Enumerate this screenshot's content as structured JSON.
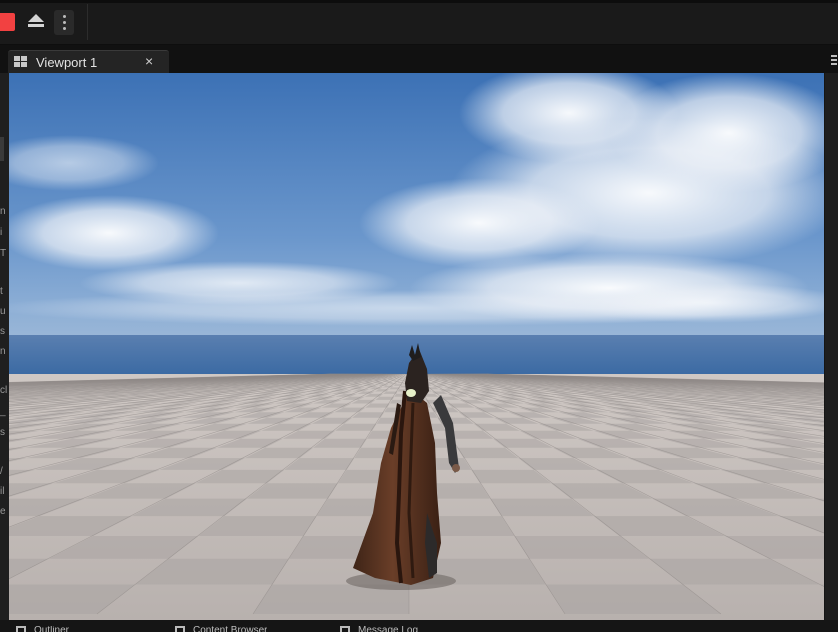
{
  "toolbar": {
    "stop_icon": "stop-square-icon",
    "eject_icon": "eject-icon",
    "more_icon": "vertical-ellipsis-icon",
    "stop_color": "#f24141"
  },
  "viewport_tab": {
    "label": "Viewport 1",
    "close": "×",
    "icon": "viewport-grid-icon"
  },
  "left_panel_cut_letters": [
    "n",
    "i",
    "T",
    "t",
    "u",
    "s",
    "n",
    "cl",
    "_",
    "s",
    "/",
    "il",
    "e"
  ],
  "bottom_tabs": [
    {
      "icon": "outliner-icon",
      "label": "Outliner"
    },
    {
      "icon": "content-browser-icon",
      "label": "Content Browser"
    },
    {
      "icon": "message-log-icon",
      "label": "Message Log"
    }
  ],
  "scene": {
    "sky_top": "#3b72b6",
    "horizon": "#3d6ea6",
    "floor_light": "#c9c3c0",
    "floor_dark": "#a9a4a2",
    "cloak": "#5b3523"
  }
}
